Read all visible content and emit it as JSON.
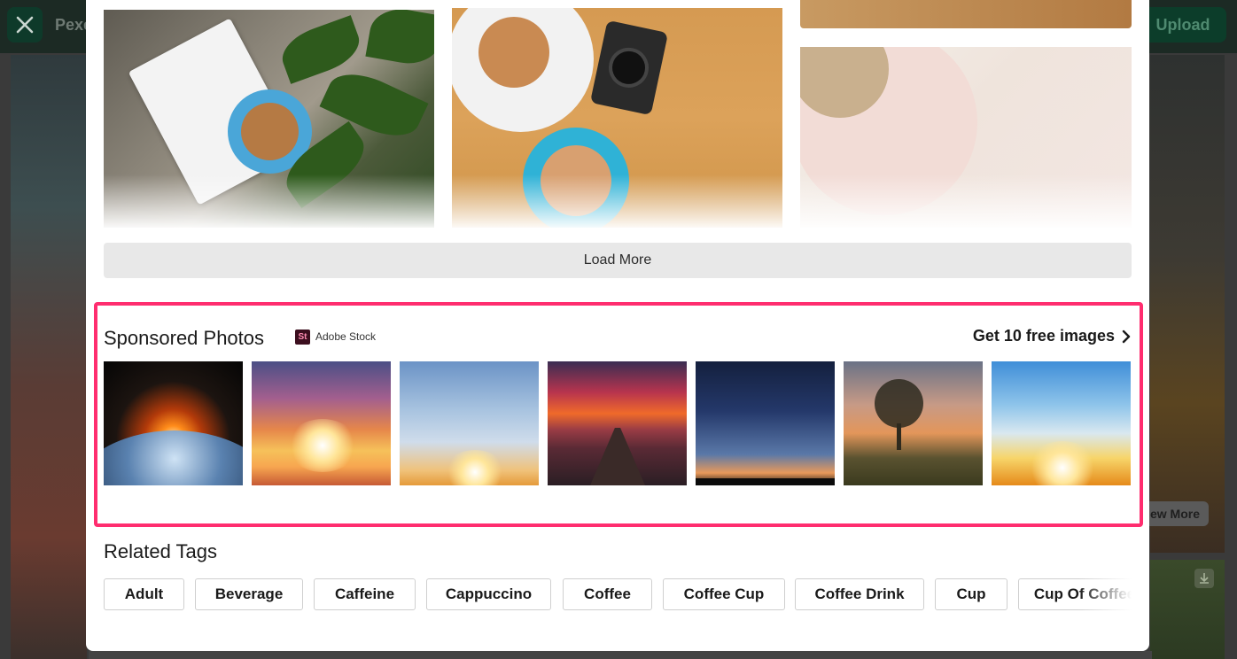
{
  "background": {
    "brand": "Pexe",
    "upload_label": "Upload",
    "view_more_label": "ew More"
  },
  "load_more_label": "Load More",
  "sponsored": {
    "title": "Sponsored Photos",
    "stock_logo": "St",
    "stock_name": "Adobe Stock",
    "free_link": "Get 10 free images",
    "border_color": "#ff2d6f"
  },
  "related": {
    "title": "Related Tags",
    "tags": [
      "Adult",
      "Beverage",
      "Caffeine",
      "Cappuccino",
      "Coffee",
      "Coffee Cup",
      "Coffee Drink",
      "Cup",
      "Cup Of Coffee"
    ]
  },
  "icons": {
    "close": "close-icon",
    "chevron": "chevron-right-icon",
    "download": "download-icon"
  }
}
